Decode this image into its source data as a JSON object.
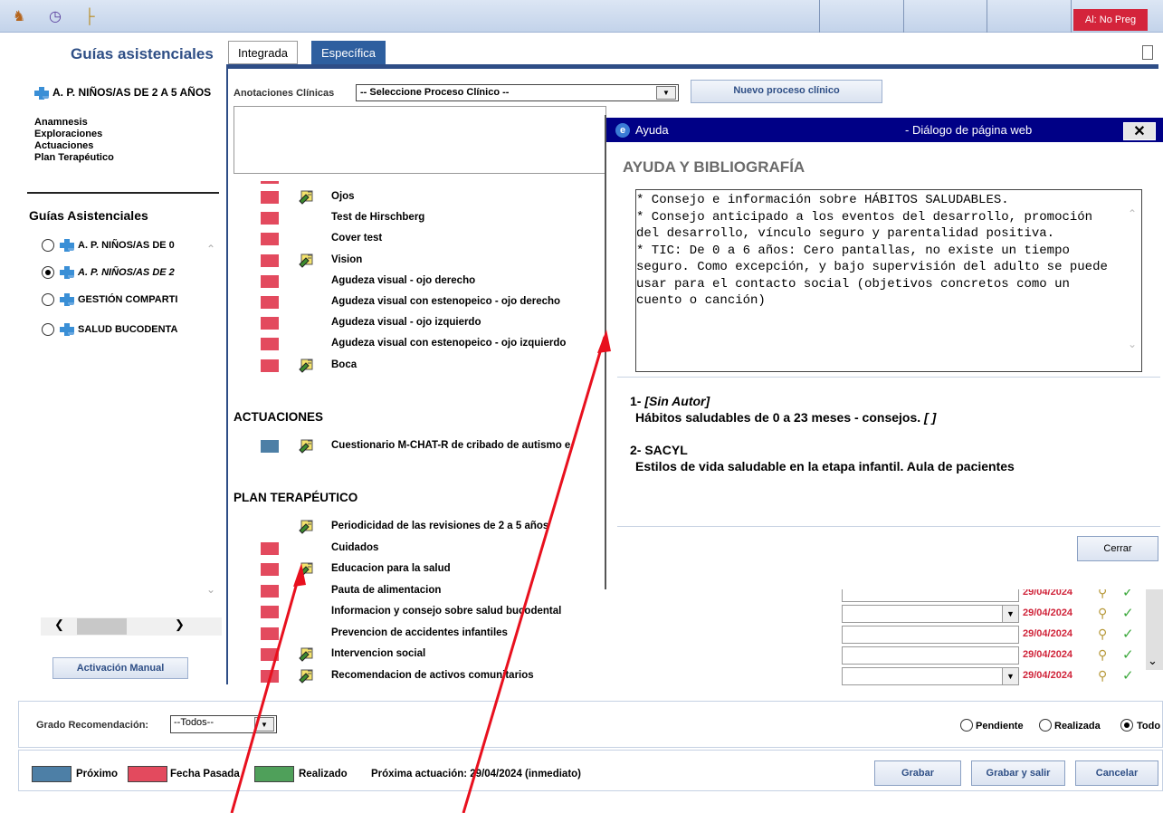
{
  "toolbar": {
    "icons": [
      "users-add-icon",
      "clock-icon",
      "tree-icon"
    ],
    "alert_label": "Al: No Preg"
  },
  "left": {
    "title": "Guías asistenciales",
    "current_guide": {
      "name": "A. P. NIÑOS/AS DE 2 A 5 AÑOS",
      "sections": [
        "Anamnesis",
        "Exploraciones",
        "Actuaciones",
        "Plan Terapéutico"
      ]
    },
    "list_title": "Guías Asistenciales",
    "guides": [
      {
        "label": "A. P. NIÑOS/AS DE 0",
        "selected": false,
        "italic": false
      },
      {
        "label": "A. P. NIÑOS/AS DE 2",
        "selected": true,
        "italic": true
      },
      {
        "label": "GESTIÓN COMPARTI",
        "selected": false,
        "italic": false
      },
      {
        "label": "SALUD BUCODENTA",
        "selected": false,
        "italic": false
      }
    ],
    "manual_button": "Activación Manual"
  },
  "tabs": [
    "Integrada",
    "Específica"
  ],
  "annotations": {
    "label": "Anotaciones Clínicas",
    "select_value": "-- Seleccione Proceso Clínico --",
    "new_button": "Nuevo proceso clínico"
  },
  "exploraciones": [
    {
      "label": "Ojos",
      "pen": true
    },
    {
      "label": "Test de Hirschberg",
      "pen": false
    },
    {
      "label": "Cover test",
      "pen": false
    },
    {
      "label": "Vision",
      "pen": true
    },
    {
      "label": "Agudeza visual - ojo derecho",
      "pen": false
    },
    {
      "label": "Agudeza visual con estenopeico - ojo derecho",
      "pen": false
    },
    {
      "label": "Agudeza visual - ojo izquierdo",
      "pen": false
    },
    {
      "label": "Agudeza visual con estenopeico - ojo izquierdo",
      "pen": false
    },
    {
      "label": "Boca",
      "pen": true
    }
  ],
  "actuaciones": {
    "title": "ACTUACIONES",
    "items": [
      {
        "label": "Cuestionario M-CHAT-R de cribado de autismo e",
        "pen": true
      }
    ]
  },
  "plan": {
    "title": "PLAN TERAPÉUTICO",
    "items": [
      {
        "label": "Periodicidad de las revisiones de 2 a 5 años",
        "pen": true,
        "sq": false
      },
      {
        "label": "Cuidados",
        "pen": false,
        "sq": true
      },
      {
        "label": "Educacion para la salud",
        "pen": true,
        "sq": true
      },
      {
        "label": "Pauta de alimentacion",
        "pen": false,
        "sq": true
      },
      {
        "label": "Informacion y consejo sobre salud bucodental",
        "pen": false,
        "sq": true
      },
      {
        "label": "Prevencion de accidentes infantiles",
        "pen": false,
        "sq": true
      },
      {
        "label": "Intervencion social",
        "pen": true,
        "sq": true
      },
      {
        "label": "Recomendacion de activos comunitarios",
        "pen": true,
        "sq": true
      }
    ]
  },
  "date_rows": [
    {
      "date": "29/04/2024",
      "select": false
    },
    {
      "date": "29/04/2024",
      "select": true
    },
    {
      "date": "29/04/2024",
      "select": false
    },
    {
      "date": "29/04/2024",
      "select": false
    },
    {
      "date": "29/04/2024",
      "select": true
    }
  ],
  "dialog": {
    "window_title": "Ayuda",
    "window_subtitle": "- Diálogo de página web",
    "heading": "AYUDA Y BIBLIOGRAFÍA",
    "help_text": "* Consejo e información sobre HÁBITOS SALUDABLES.\n* Consejo anticipado a los eventos del desarrollo, promoción del desarrollo, vínculo seguro y parentalidad positiva.\n* TIC: De 0 a 6 años: Cero pantallas, no existe un tiempo seguro. Como excepción, y bajo supervisión del adulto se puede usar para el contacto social (objetivos concretos como un cuento o canción)",
    "refs": [
      {
        "num": "1-",
        "author": "[Sin Autor]",
        "title": "Hábitos saludables de 0 a 23 meses - consejos.",
        "suffix": "[ ]"
      },
      {
        "num": "2-",
        "author": "SACYL",
        "title": "Estilos de vida saludable en la etapa infantil. Aula de pacientes",
        "suffix": ""
      }
    ],
    "close_button": "Cerrar"
  },
  "footer": {
    "grado_label": "Grado Recomendación:",
    "grado_value": "--Todos--",
    "filters": [
      {
        "label": "Pendiente",
        "selected": false
      },
      {
        "label": "Realizada",
        "selected": false
      },
      {
        "label": "Todo",
        "selected": true
      }
    ],
    "legend": [
      {
        "label": "Próximo",
        "color": "#4d7fa6"
      },
      {
        "label": "Fecha Pasada",
        "color": "#e34a5e"
      },
      {
        "label": "Realizado",
        "color": "#4fa05a"
      }
    ],
    "next_action": "Próxima actuación: 29/04/2024 (inmediato)",
    "buttons": [
      "Grabar",
      "Grabar y salir",
      "Cancelar"
    ]
  },
  "colors": {
    "accent": "#2e5f9f",
    "overdue": "#e34a5e",
    "alert": "#d4243b",
    "arrow": "#e8101e"
  }
}
